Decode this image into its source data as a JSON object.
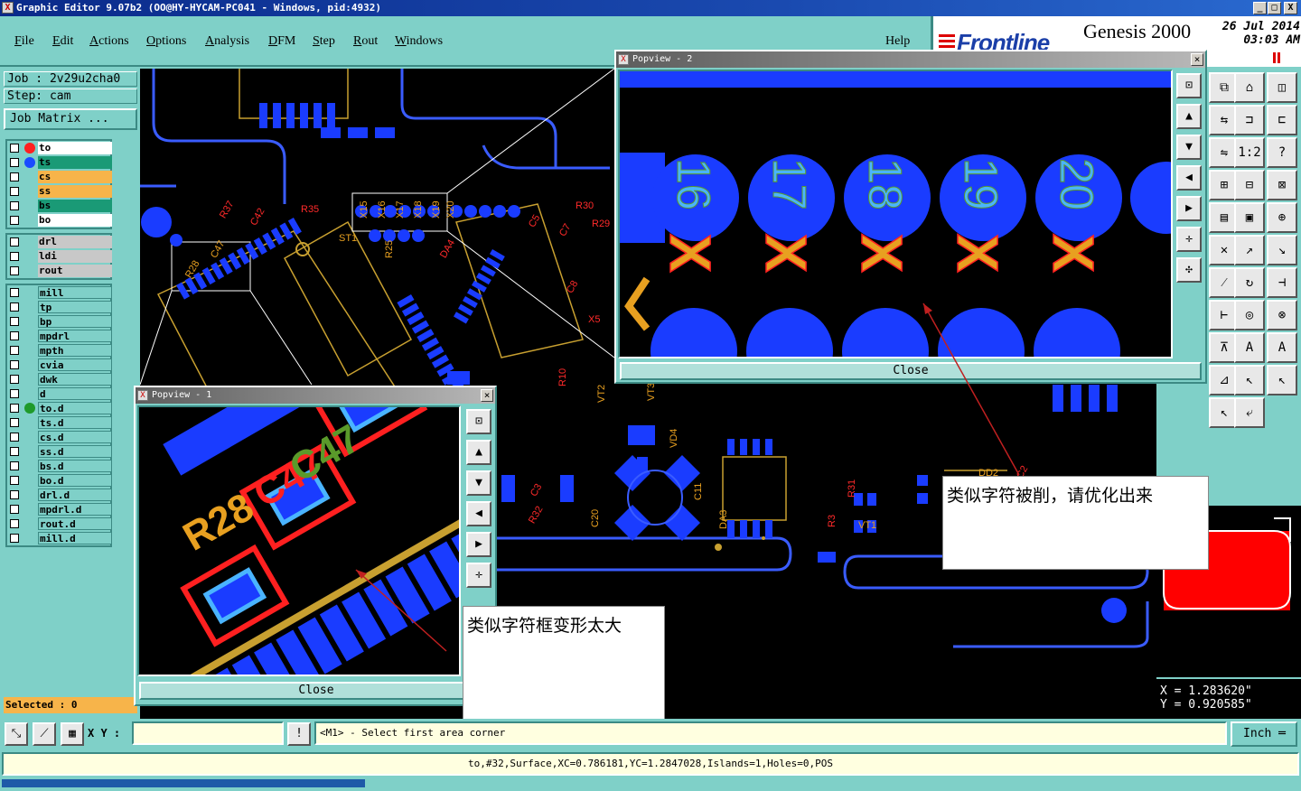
{
  "window": {
    "title": "Graphic Editor 9.07b2 (OO@HY-HYCAM-PC041 - Windows, pid:4932)",
    "minimize": "_",
    "maximize": "□",
    "close": "X",
    "icon": "X"
  },
  "menu": {
    "items": [
      "File",
      "Edit",
      "Actions",
      "Options",
      "Analysis",
      "DFM",
      "Step",
      "Rout",
      "Windows"
    ],
    "help": "Help"
  },
  "brand": {
    "logo": "Frontline",
    "product": "Genesis 2000",
    "date": "26 Jul 2014",
    "time": "03:03 AM"
  },
  "job": {
    "job_line": "Job : 2v29u2cha0",
    "step_line": "Step: cam",
    "matrix_button": "Job Matrix ..."
  },
  "layers": {
    "groups": [
      [
        {
          "name": "to",
          "dot": "#ff2020",
          "bg": "#ffffff"
        },
        {
          "name": "ts",
          "dot": "#1a4bff",
          "bg": "#1a9a76"
        },
        {
          "name": "cs",
          "dot": "",
          "bg": "#f7b44a"
        },
        {
          "name": "ss",
          "dot": "",
          "bg": "#f7b44a"
        },
        {
          "name": "bs",
          "dot": "",
          "bg": "#1a9a76"
        },
        {
          "name": "bo",
          "dot": "",
          "bg": "#ffffff"
        }
      ],
      [
        {
          "name": "drl",
          "dot": "",
          "bg": "#c8c8c8"
        },
        {
          "name": "ldi",
          "dot": "",
          "bg": "#c8c8c8"
        },
        {
          "name": "rout",
          "dot": "",
          "bg": "#c8c8c8"
        }
      ],
      [
        {
          "name": "mill",
          "dot": "",
          "bg": "#7fd0c8"
        },
        {
          "name": "tp",
          "dot": "",
          "bg": "#7fd0c8"
        },
        {
          "name": "bp",
          "dot": "",
          "bg": "#7fd0c8"
        },
        {
          "name": "mpdrl",
          "dot": "",
          "bg": "#7fd0c8"
        },
        {
          "name": "mpth",
          "dot": "",
          "bg": "#7fd0c8"
        },
        {
          "name": "cvia",
          "dot": "",
          "bg": "#7fd0c8"
        },
        {
          "name": "dwk",
          "dot": "",
          "bg": "#7fd0c8"
        },
        {
          "name": "d",
          "dot": "",
          "bg": "#7fd0c8"
        },
        {
          "name": "to.d",
          "dot": "#1f9a2a",
          "bg": "#7fd0c8"
        },
        {
          "name": "ts.d",
          "dot": "",
          "bg": "#7fd0c8"
        },
        {
          "name": "cs.d",
          "dot": "",
          "bg": "#7fd0c8"
        },
        {
          "name": "ss.d",
          "dot": "",
          "bg": "#7fd0c8"
        },
        {
          "name": "bs.d",
          "dot": "",
          "bg": "#7fd0c8"
        },
        {
          "name": "bo.d",
          "dot": "",
          "bg": "#7fd0c8"
        },
        {
          "name": "drl.d",
          "dot": "",
          "bg": "#7fd0c8"
        },
        {
          "name": "mpdrl.d",
          "dot": "",
          "bg": "#7fd0c8"
        },
        {
          "name": "rout.d",
          "dot": "",
          "bg": "#7fd0c8"
        },
        {
          "name": "mill.d",
          "dot": "",
          "bg": "#7fd0c8"
        }
      ]
    ],
    "selected": "Selected : 0"
  },
  "canvas_labels": [
    "R35",
    "R30",
    "R29",
    "R37",
    "C42",
    "R28",
    "C47",
    "ST1",
    "X15",
    "X16",
    "X17",
    "X18",
    "X19",
    "X20",
    "R25",
    "DA4",
    "C5",
    "C7",
    "C8",
    "R10",
    "VT2",
    "VT3",
    "VD4",
    "C11",
    "DA3",
    "C20",
    "DD2",
    "R3",
    "VT1",
    "R31",
    "C2",
    "C3",
    "R32",
    "X5"
  ],
  "popview1": {
    "title": "Popview - 1",
    "close": "Close",
    "labels": [
      "R28",
      "C47",
      "C47"
    ]
  },
  "popview2": {
    "title": "Popview - 2",
    "close": "Close",
    "pin_labels": [
      "16",
      "17",
      "18",
      "19",
      "20"
    ],
    "x_labels": [
      "X",
      "X",
      "X",
      "X",
      "X"
    ]
  },
  "annotations": {
    "popview1_note": "类似字符框变形太大",
    "popview2_note": "类似字符被削，请优化出来"
  },
  "coordinates": {
    "x": "X = 1.283620\"",
    "y": "Y = 0.920585\""
  },
  "bottom": {
    "xy_label": "X Y :",
    "xy_value": "",
    "bang": "!",
    "message": "<M1> - Select first area corner",
    "unit": "Inch",
    "info": "to,#32,Surface,XC=0.786181,YC=1.2847028,Islands=1,Holes=0,POS",
    "progress": 0.28
  },
  "colors": {
    "pad_blue": "#1a3cff",
    "silk_orange": "#e8a020",
    "silk_red": "#ff2a2a",
    "trace_blue": "#3a5cff",
    "outline_yellow": "#c8a030",
    "minimap_red": "#ff0000"
  }
}
